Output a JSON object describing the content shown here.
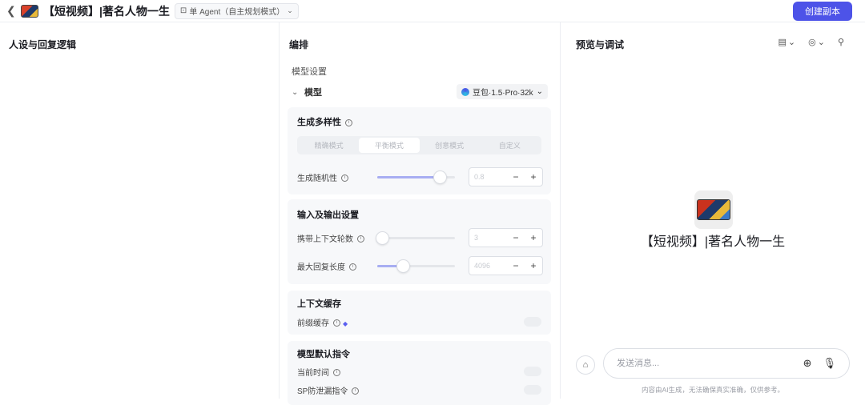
{
  "header": {
    "title": "【短视频】|著名人物一生",
    "mode_label": "单 Agent（自主规划模式）",
    "create_copy_label": "创建副本"
  },
  "persona": {
    "title": "人设与回复逻辑"
  },
  "arrange": {
    "title": "编排",
    "model_settings": "模型设置",
    "model_label": "模型",
    "model_value": "豆包·1.5·Pro·32k",
    "diversity": {
      "title": "生成多样性",
      "modes": [
        "精确模式",
        "平衡模式",
        "创意模式",
        "自定义"
      ],
      "active": 1,
      "randomness_label": "生成随机性",
      "randomness_value": "0.8",
      "randomness_level": 0.8
    },
    "io": {
      "title": "输入及输出设置",
      "context_rounds_label": "携带上下文轮数",
      "context_rounds_value": "3",
      "context_rounds_level": 0.0,
      "max_reply_label": "最大回复长度",
      "max_reply_value": "4096",
      "max_reply_level": 0.33
    },
    "cache": {
      "title": "上下文缓存",
      "prefix_label": "前缀缓存"
    },
    "default_instructions": {
      "title": "模型默认指令",
      "current_time_label": "当前时间",
      "sp_leak_label": "SP防泄漏指令"
    }
  },
  "preview": {
    "title": "预览与调试",
    "bot_name": "【短视频】|著名人物一生",
    "input_placeholder": "发送消息...",
    "disclaimer": "内容由AI生成，无法确保真实准确，仅供参考。"
  },
  "colors": {
    "accent": "#4d53e8"
  }
}
